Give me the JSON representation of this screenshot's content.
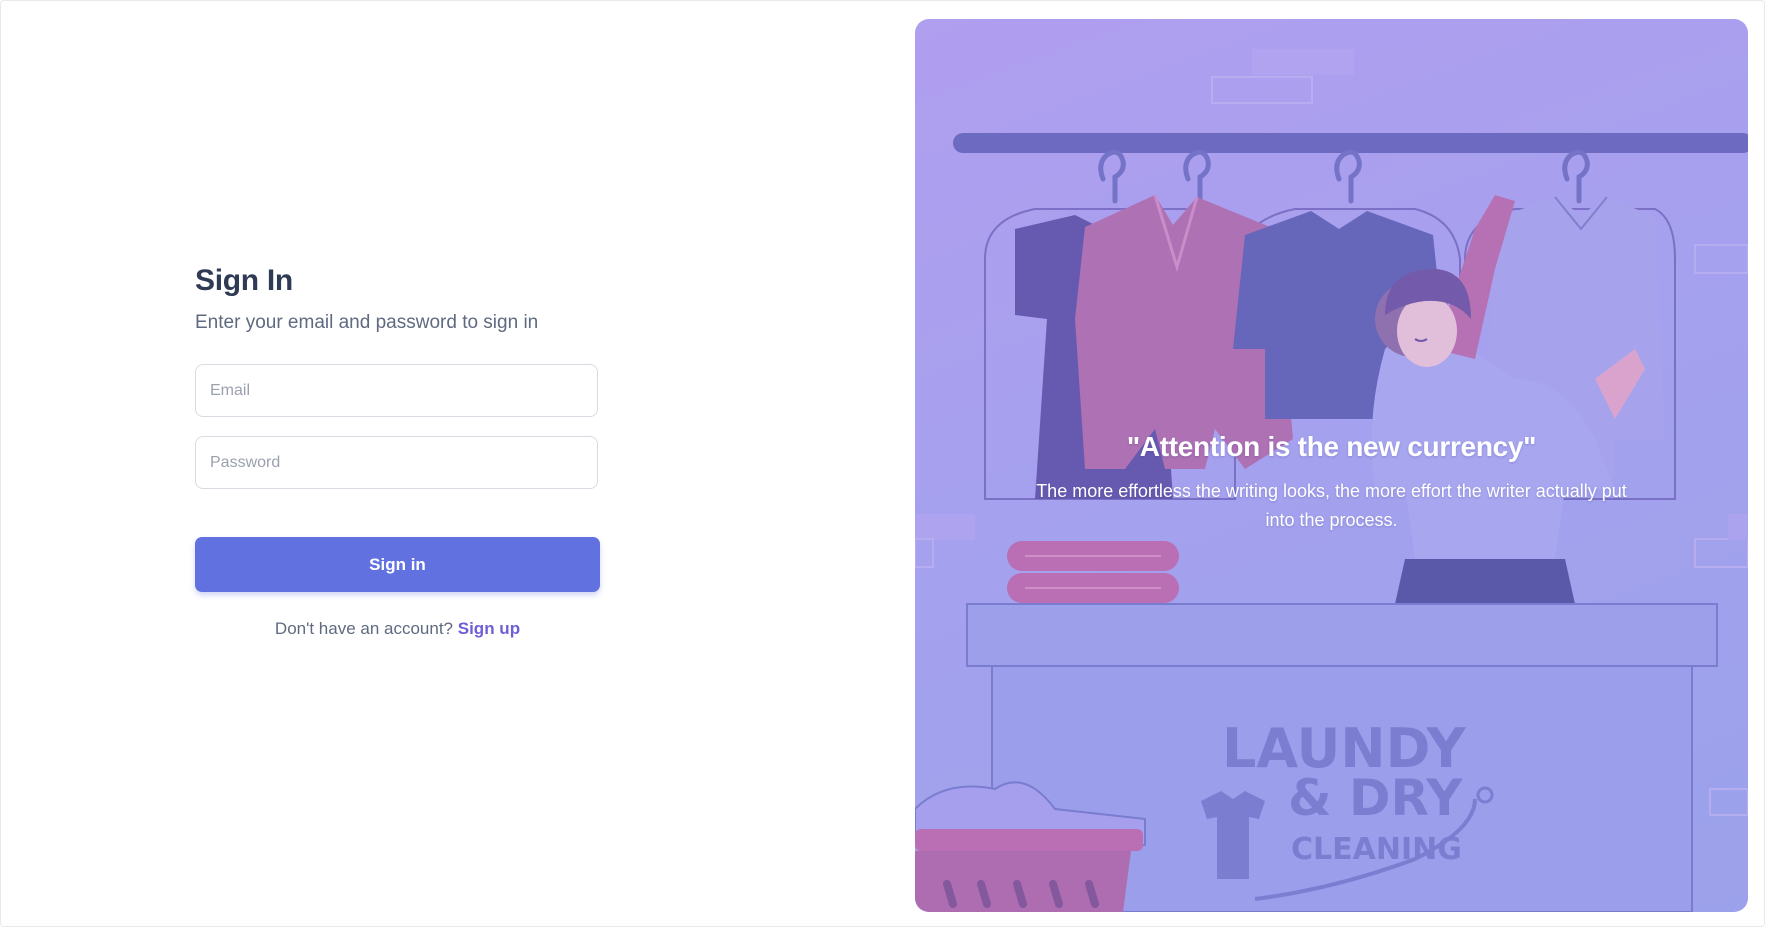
{
  "signin": {
    "title": "Sign In",
    "subtitle": "Enter your email and password to sign in",
    "email_placeholder": "Email",
    "password_placeholder": "Password",
    "button_label": "Sign in",
    "no_account_text": "Don't have an account?",
    "signup_link": "Sign up"
  },
  "hero": {
    "quote_title": "\"Attention is the new currency\"",
    "quote_text": "The more effortless the writing looks, the more effort the writer actually put into the process.",
    "logo_line1": "LAUNDY",
    "logo_line2": "& DRY",
    "logo_line3": "CLEANING"
  },
  "colors": {
    "primary": "#6271e0",
    "link": "#6d5fd6",
    "title": "#2f3a55",
    "hero_gradient_start": "#b4a0ef",
    "hero_gradient_end": "#9aa4ea"
  }
}
